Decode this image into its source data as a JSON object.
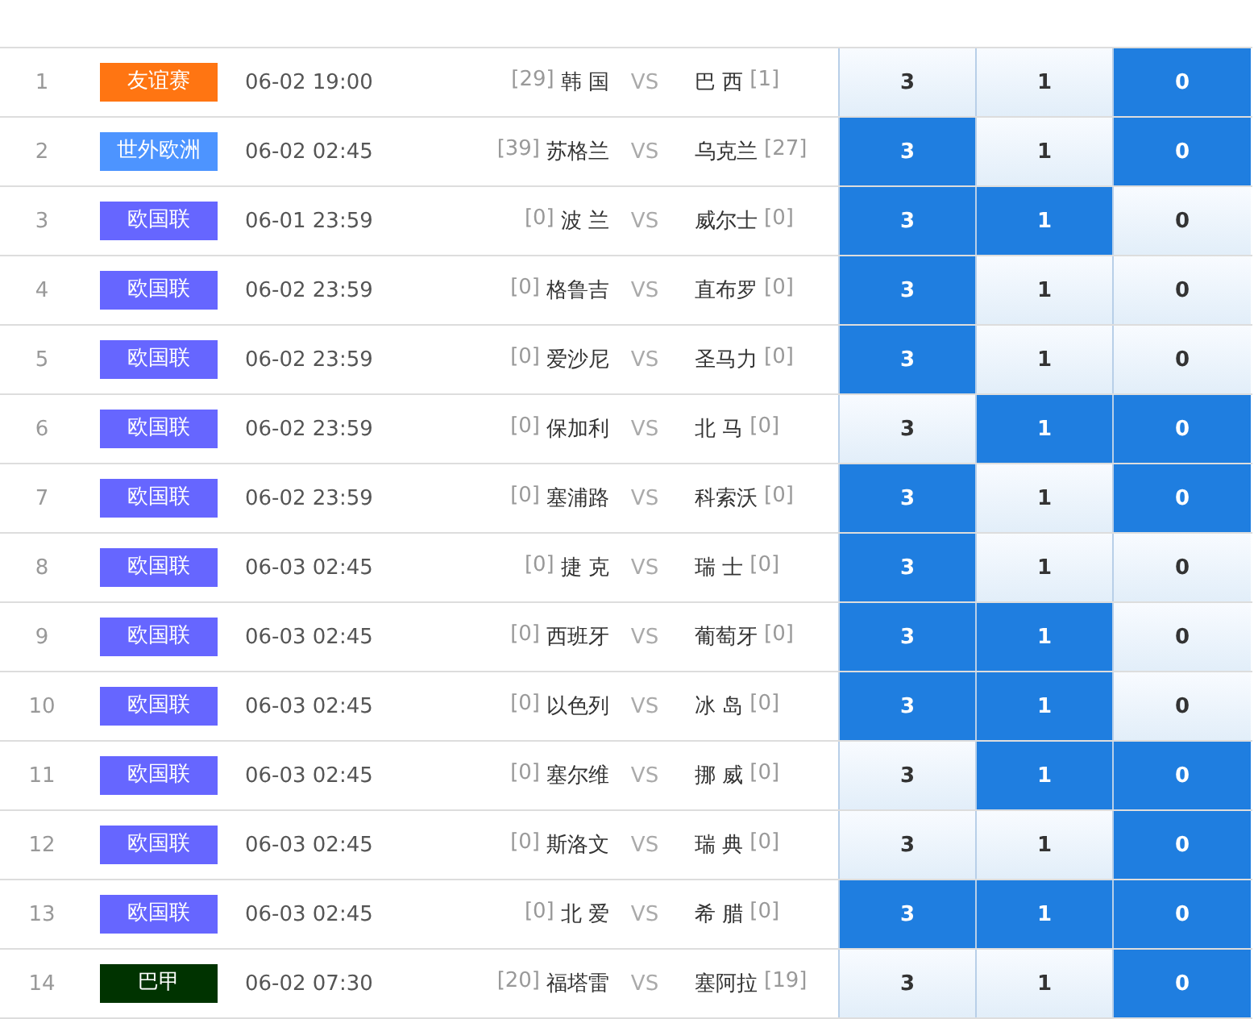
{
  "matches": [
    {
      "no": "1",
      "league": "友谊赛",
      "color": "#ff7512",
      "time": "06-02 19:00",
      "home_rank": "[29]",
      "home": "韩 国",
      "vs": "VS",
      "away": "巴 西",
      "away_rank": "[1]",
      "options": [
        {
          "label": "3",
          "selected": false
        },
        {
          "label": "1",
          "selected": false
        },
        {
          "label": "0",
          "selected": true
        }
      ]
    },
    {
      "no": "2",
      "league": "世外欧洲",
      "color": "#4d94ff",
      "time": "06-02 02:45",
      "home_rank": "[39]",
      "home": "苏格兰",
      "vs": "VS",
      "away": "乌克兰",
      "away_rank": "[27]",
      "options": [
        {
          "label": "3",
          "selected": true
        },
        {
          "label": "1",
          "selected": false
        },
        {
          "label": "0",
          "selected": true
        }
      ]
    },
    {
      "no": "3",
      "league": "欧国联",
      "color": "#6666ff",
      "time": "06-01 23:59",
      "home_rank": "[0]",
      "home": "波 兰",
      "vs": "VS",
      "away": "威尔士",
      "away_rank": "[0]",
      "options": [
        {
          "label": "3",
          "selected": true
        },
        {
          "label": "1",
          "selected": true
        },
        {
          "label": "0",
          "selected": false
        }
      ]
    },
    {
      "no": "4",
      "league": "欧国联",
      "color": "#6666ff",
      "time": "06-02 23:59",
      "home_rank": "[0]",
      "home": "格鲁吉",
      "vs": "VS",
      "away": "直布罗",
      "away_rank": "[0]",
      "options": [
        {
          "label": "3",
          "selected": true
        },
        {
          "label": "1",
          "selected": false
        },
        {
          "label": "0",
          "selected": false
        }
      ]
    },
    {
      "no": "5",
      "league": "欧国联",
      "color": "#6666ff",
      "time": "06-02 23:59",
      "home_rank": "[0]",
      "home": "爱沙尼",
      "vs": "VS",
      "away": "圣马力",
      "away_rank": "[0]",
      "options": [
        {
          "label": "3",
          "selected": true
        },
        {
          "label": "1",
          "selected": false
        },
        {
          "label": "0",
          "selected": false
        }
      ]
    },
    {
      "no": "6",
      "league": "欧国联",
      "color": "#6666ff",
      "time": "06-02 23:59",
      "home_rank": "[0]",
      "home": "保加利",
      "vs": "VS",
      "away": "北 马",
      "away_rank": "[0]",
      "options": [
        {
          "label": "3",
          "selected": false
        },
        {
          "label": "1",
          "selected": true
        },
        {
          "label": "0",
          "selected": true
        }
      ]
    },
    {
      "no": "7",
      "league": "欧国联",
      "color": "#6666ff",
      "time": "06-02 23:59",
      "home_rank": "[0]",
      "home": "塞浦路",
      "vs": "VS",
      "away": "科索沃",
      "away_rank": "[0]",
      "options": [
        {
          "label": "3",
          "selected": true
        },
        {
          "label": "1",
          "selected": false
        },
        {
          "label": "0",
          "selected": true
        }
      ]
    },
    {
      "no": "8",
      "league": "欧国联",
      "color": "#6666ff",
      "time": "06-03 02:45",
      "home_rank": "[0]",
      "home": "捷 克",
      "vs": "VS",
      "away": "瑞 士",
      "away_rank": "[0]",
      "options": [
        {
          "label": "3",
          "selected": true
        },
        {
          "label": "1",
          "selected": false
        },
        {
          "label": "0",
          "selected": false
        }
      ]
    },
    {
      "no": "9",
      "league": "欧国联",
      "color": "#6666ff",
      "time": "06-03 02:45",
      "home_rank": "[0]",
      "home": "西班牙",
      "vs": "VS",
      "away": "葡萄牙",
      "away_rank": "[0]",
      "options": [
        {
          "label": "3",
          "selected": true
        },
        {
          "label": "1",
          "selected": true
        },
        {
          "label": "0",
          "selected": false
        }
      ]
    },
    {
      "no": "10",
      "league": "欧国联",
      "color": "#6666ff",
      "time": "06-03 02:45",
      "home_rank": "[0]",
      "home": "以色列",
      "vs": "VS",
      "away": "冰 岛",
      "away_rank": "[0]",
      "options": [
        {
          "label": "3",
          "selected": true
        },
        {
          "label": "1",
          "selected": true
        },
        {
          "label": "0",
          "selected": false
        }
      ]
    },
    {
      "no": "11",
      "league": "欧国联",
      "color": "#6666ff",
      "time": "06-03 02:45",
      "home_rank": "[0]",
      "home": "塞尔维",
      "vs": "VS",
      "away": "挪 威",
      "away_rank": "[0]",
      "options": [
        {
          "label": "3",
          "selected": false
        },
        {
          "label": "1",
          "selected": true
        },
        {
          "label": "0",
          "selected": true
        }
      ]
    },
    {
      "no": "12",
      "league": "欧国联",
      "color": "#6666ff",
      "time": "06-03 02:45",
      "home_rank": "[0]",
      "home": "斯洛文",
      "vs": "VS",
      "away": "瑞 典",
      "away_rank": "[0]",
      "options": [
        {
          "label": "3",
          "selected": false
        },
        {
          "label": "1",
          "selected": false
        },
        {
          "label": "0",
          "selected": true
        }
      ]
    },
    {
      "no": "13",
      "league": "欧国联",
      "color": "#6666ff",
      "time": "06-03 02:45",
      "home_rank": "[0]",
      "home": "北 爱",
      "vs": "VS",
      "away": "希 腊",
      "away_rank": "[0]",
      "options": [
        {
          "label": "3",
          "selected": true
        },
        {
          "label": "1",
          "selected": true
        },
        {
          "label": "0",
          "selected": true
        }
      ]
    },
    {
      "no": "14",
      "league": "巴甲",
      "color": "#003300",
      "time": "06-02 07:30",
      "home_rank": "[20]",
      "home": "福塔雷",
      "vs": "VS",
      "away": "塞阿拉",
      "away_rank": "[19]",
      "options": [
        {
          "label": "3",
          "selected": false
        },
        {
          "label": "1",
          "selected": false
        },
        {
          "label": "0",
          "selected": true
        }
      ]
    }
  ]
}
